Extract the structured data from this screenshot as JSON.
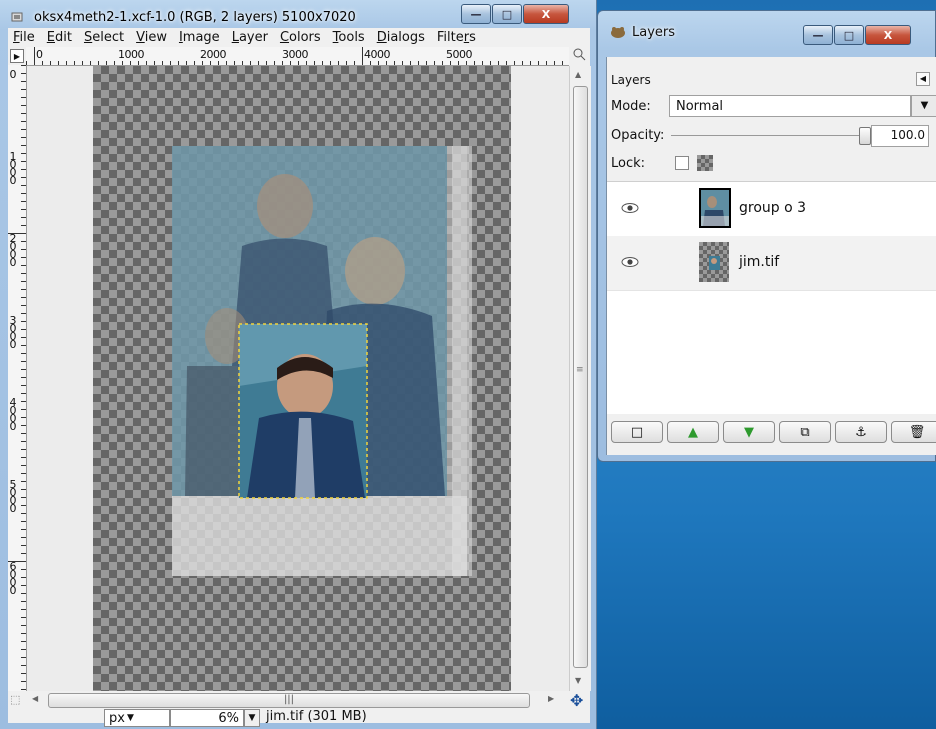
{
  "main_window": {
    "title": "oksx4meth2-1.xcf-1.0 (RGB, 2 layers) 5100x7020",
    "menu": [
      {
        "label": "File",
        "u": "F"
      },
      {
        "label": "Edit",
        "u": "E"
      },
      {
        "label": "Select",
        "u": "S"
      },
      {
        "label": "View",
        "u": "V"
      },
      {
        "label": "Image",
        "u": "I"
      },
      {
        "label": "Layer",
        "u": "L"
      },
      {
        "label": "Colors",
        "u": "C"
      },
      {
        "label": "Tools",
        "u": "T"
      },
      {
        "label": "Dialogs",
        "u": "D"
      },
      {
        "label": "Filters",
        "u": "r"
      }
    ],
    "ruler_top_labels": [
      "0",
      "1000",
      "2000",
      "3000",
      "4000",
      "5000"
    ],
    "ruler_left_labels": [
      "0",
      "1000",
      "2000",
      "3000",
      "4000",
      "5000",
      "6000"
    ],
    "status": {
      "unit": "px",
      "zoom": "6%",
      "info": "jim.tif (301 MB)"
    }
  },
  "layers_window": {
    "title": "Layers",
    "panel_title": "Layers",
    "mode_label": "Mode:",
    "mode_value": "Normal",
    "opacity_label": "Opacity:",
    "opacity_value": "100.0",
    "lock_label": "Lock:",
    "layers": [
      {
        "name": "group o 3",
        "visible": true
      },
      {
        "name": "jim.tif",
        "visible": true
      }
    ]
  },
  "icons": {
    "eye": "eye-icon",
    "new": "new-layer-icon",
    "raise": "raise-layer-icon",
    "lower": "lower-layer-icon",
    "duplicate": "duplicate-layer-icon",
    "anchor": "anchor-layer-icon",
    "delete": "delete-layer-icon"
  }
}
